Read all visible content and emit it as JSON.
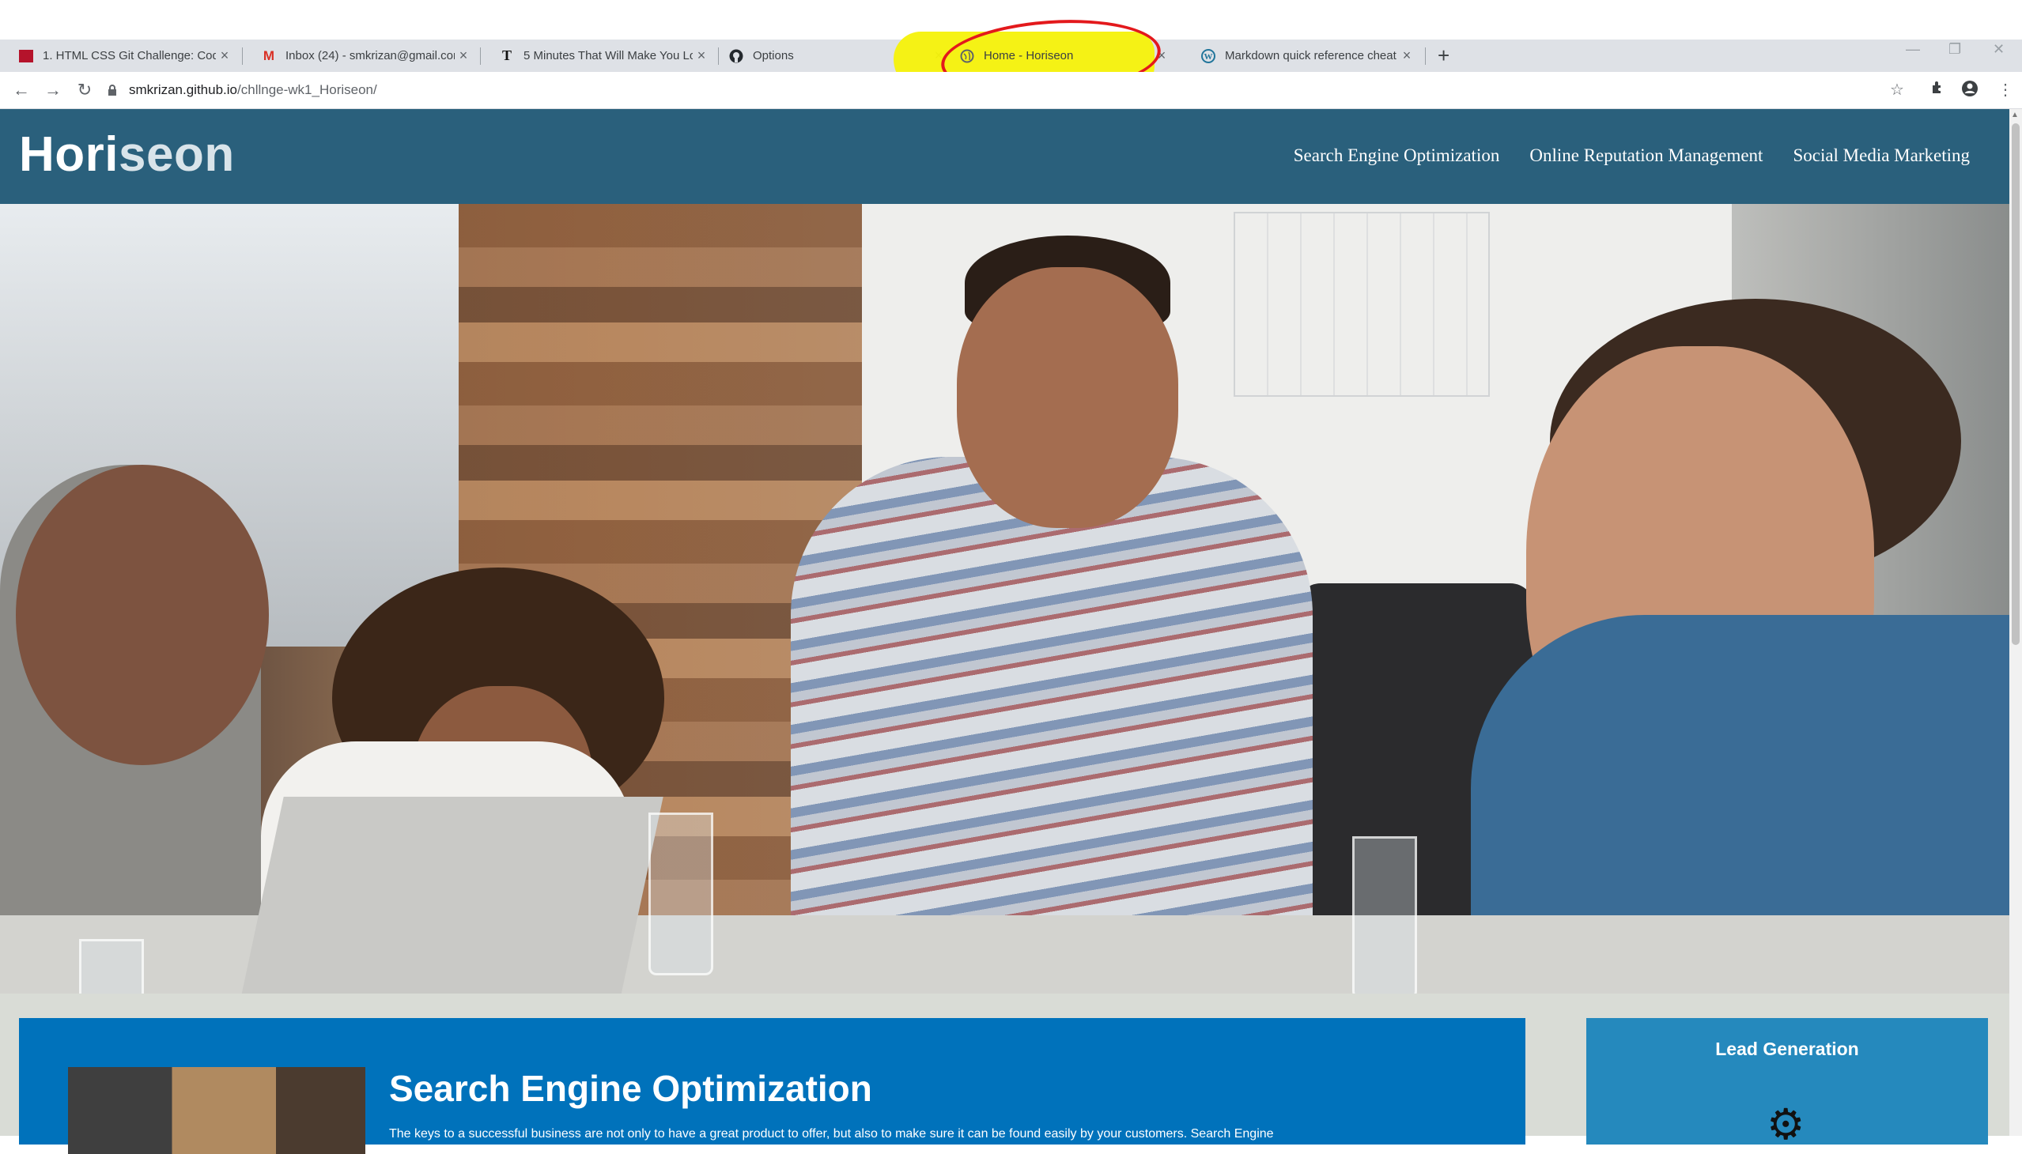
{
  "browser": {
    "tabs": [
      {
        "title": "1. HTML CSS Git Challenge: Code",
        "favicon": "trilogy-icon",
        "active": false
      },
      {
        "title": "Inbox (24) - smkrizan@gmail.com",
        "favicon": "gmail-icon",
        "active": false
      },
      {
        "title": "5 Minutes That Will Make You Lo",
        "favicon": "nytimes-icon",
        "active": false
      },
      {
        "title": "Options",
        "favicon": "github-icon",
        "active": false
      },
      {
        "title": "Home - Horiseon",
        "favicon": "globe-icon",
        "active": true
      },
      {
        "title": "Markdown quick reference cheat",
        "favicon": "wordpress-icon",
        "active": false
      }
    ],
    "url_host": "smkrizan.github.io",
    "url_path": "/chllnge-wk1_Horiseon/",
    "new_tab_glyph": "+",
    "close_glyph": "×"
  },
  "site": {
    "logo_prefix": "Hori",
    "logo_suffix": "seon",
    "nav": [
      "Search Engine Optimization",
      "Online Reputation Management",
      "Social Media Marketing"
    ]
  },
  "main": {
    "card_title": "Search Engine Optimization",
    "card_text": "The keys to a successful business are not only to have a great product to offer, but also to make sure it can be found easily by your customers. Search Engine"
  },
  "sidebar": {
    "title": "Lead Generation",
    "icon": "gear-icon"
  },
  "colors": {
    "header_bg": "#2a607c",
    "card_bg": "#0072bb",
    "side_card_bg": "#2589bd",
    "annotation_highlight": "#f6f20a",
    "annotation_circle": "#e3191c"
  }
}
